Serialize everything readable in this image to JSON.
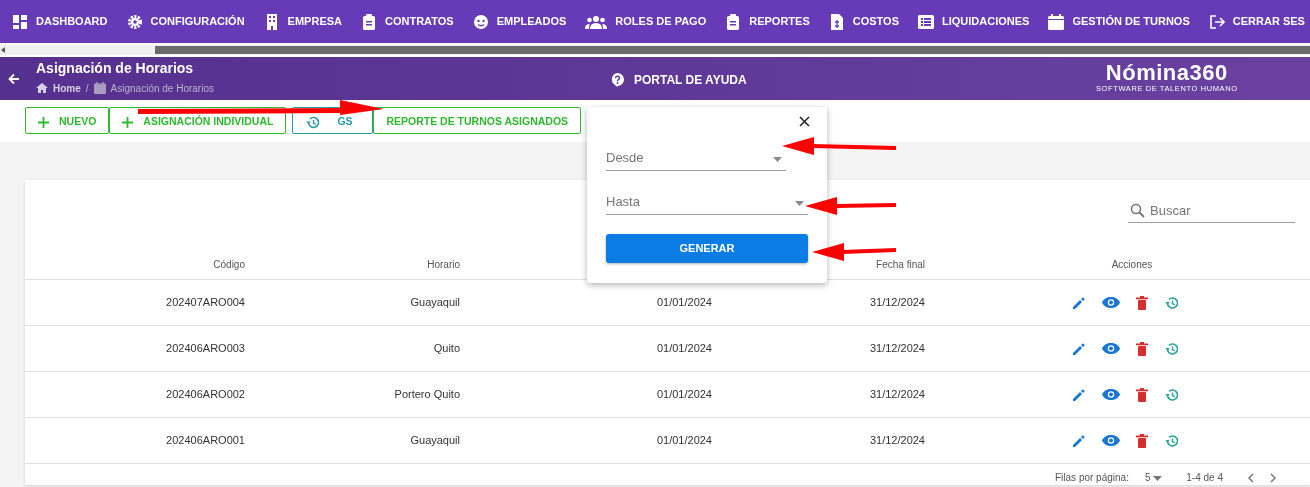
{
  "nav": [
    {
      "label": "DASHBOARD"
    },
    {
      "label": "CONFIGURACIÓN"
    },
    {
      "label": "EMPRESA"
    },
    {
      "label": "CONTRATOS"
    },
    {
      "label": "EMPLEADOS"
    },
    {
      "label": "ROLES DE PAGO"
    },
    {
      "label": "REPORTES"
    },
    {
      "label": "COSTOS"
    },
    {
      "label": "LIQUIDACIONES"
    },
    {
      "label": "GESTIÓN DE TURNOS"
    },
    {
      "label": "CERRAR SES"
    }
  ],
  "header": {
    "title": "Asignación de Horarios",
    "breadcrumb": [
      "Home",
      "Asignación de Horarios"
    ],
    "breadcrumb_separator": "/",
    "help": "PORTAL DE AYUDA",
    "logo": "Nómina360",
    "logo_tagline": "SOFTWARE DE TALENTO HUMANO"
  },
  "toolbar": [
    {
      "label": "NUEVO",
      "kind": "add"
    },
    {
      "label": "ASIGNACIÓN INDIVIDUAL",
      "kind": "add"
    },
    {
      "label": "GS",
      "kind": "history"
    },
    {
      "label": "REPORTE DE TURNOS ASIGNADOS",
      "kind": "plain"
    }
  ],
  "popover": {
    "fields": [
      {
        "placeholder": "Desde"
      },
      {
        "placeholder": "Hasta"
      }
    ],
    "button": "GENERAR"
  },
  "search": {
    "placeholder": "Buscar"
  },
  "table": {
    "columns": {
      "column_1": "Código",
      "column_2": "Horario",
      "column_4": "Fecha final",
      "column_5": "Acciones"
    },
    "rows": [
      [
        "202407ARO004",
        "Guayaquil",
        "01/01/2024",
        "31/12/2024"
      ],
      [
        "202406ARO003",
        "Quito",
        "01/01/2024",
        "31/12/2024"
      ],
      [
        "202406ARO002",
        "Portero Quito",
        "01/01/2024",
        "31/12/2024"
      ],
      [
        "202406ARO001",
        "Guayaquil",
        "01/01/2024",
        "31/12/2024"
      ]
    ]
  },
  "footer": {
    "rows_per_page_label": "Filas por página:",
    "rows_per_page": "5",
    "range": "1-4 de 4"
  }
}
